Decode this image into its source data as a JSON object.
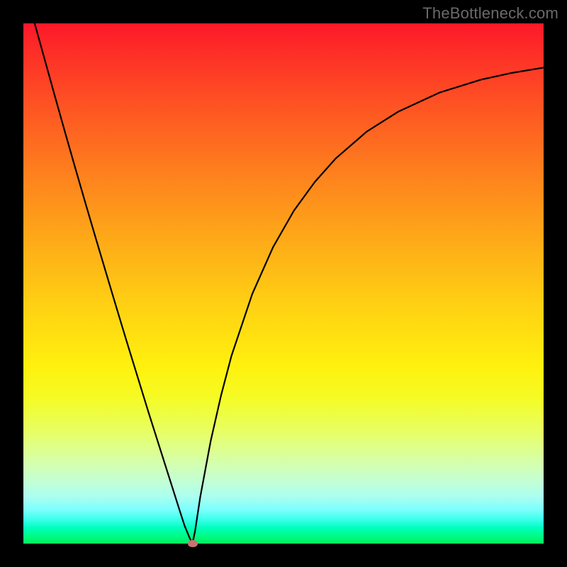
{
  "watermark": "TheBottleneck.com",
  "chart_data": {
    "type": "line",
    "title": "",
    "xlabel": "",
    "ylabel": "",
    "xlim": [
      0,
      1
    ],
    "ylim": [
      0,
      1
    ],
    "x": [
      0.0,
      0.02,
      0.04,
      0.06,
      0.08,
      0.1,
      0.12,
      0.14,
      0.16,
      0.18,
      0.2,
      0.22,
      0.24,
      0.26,
      0.28,
      0.3,
      0.31,
      0.32,
      0.325,
      0.33,
      0.34,
      0.36,
      0.38,
      0.4,
      0.44,
      0.48,
      0.52,
      0.56,
      0.6,
      0.66,
      0.72,
      0.8,
      0.88,
      0.94,
      1.0
    ],
    "values": [
      1.08,
      1.006,
      0.934,
      0.862,
      0.791,
      0.721,
      0.652,
      0.584,
      0.517,
      0.45,
      0.384,
      0.319,
      0.254,
      0.191,
      0.128,
      0.065,
      0.034,
      0.01,
      0.0,
      0.024,
      0.09,
      0.197,
      0.285,
      0.361,
      0.48,
      0.57,
      0.64,
      0.695,
      0.74,
      0.792,
      0.83,
      0.867,
      0.892,
      0.905,
      0.915
    ],
    "optimum_point": {
      "x": 0.325,
      "y": 0.0
    },
    "background_gradient": {
      "top": "#fd1729",
      "bottom": "#00ed5d"
    }
  }
}
